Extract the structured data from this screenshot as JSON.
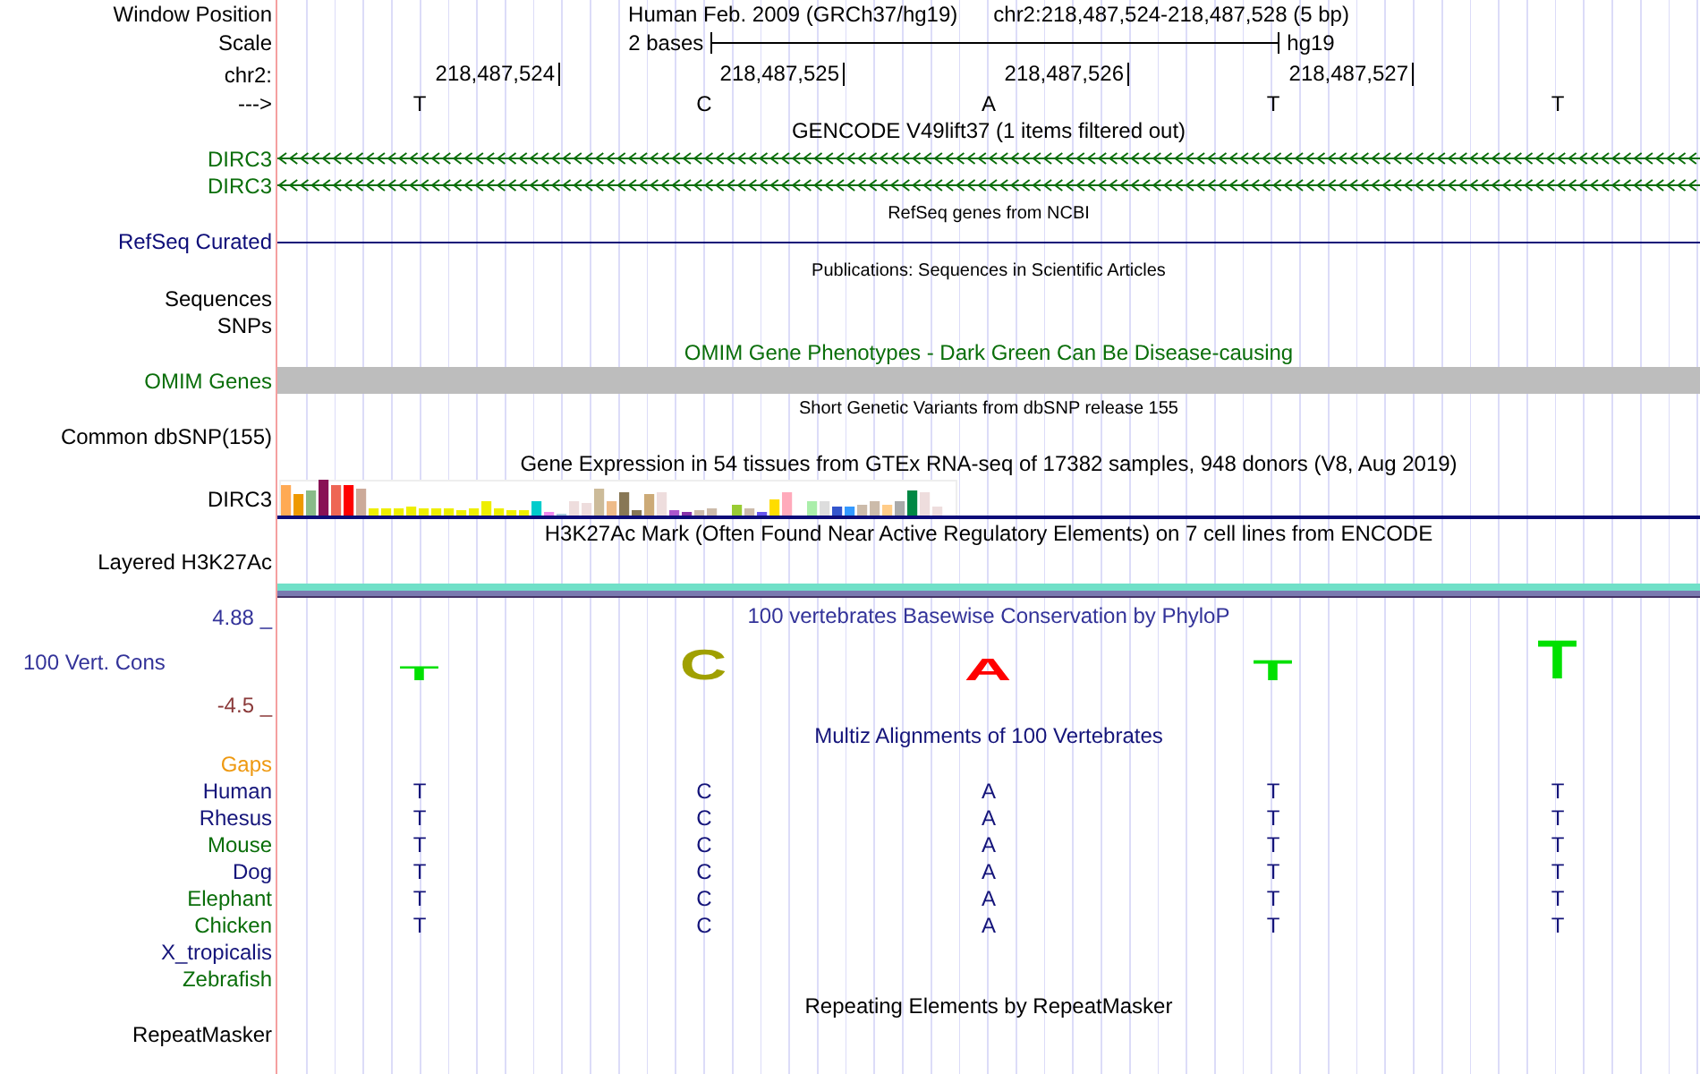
{
  "rows": [
    {
      "kind": "position",
      "label": "Window Position",
      "items": [
        "Human Feb. 2009 (GRCh37/hg19)",
        "chr2:218,487,524-218,487,528 (5 bp)"
      ]
    },
    {
      "kind": "scale",
      "label": "Scale",
      "span": "2 bases",
      "assembly": "hg19"
    },
    {
      "kind": "coords",
      "label": "chr2:",
      "ticks": [
        "218,487,524",
        "218,487,525",
        "218,487,526",
        "218,487,527"
      ]
    },
    {
      "kind": "bases",
      "label": "--->",
      "bases": [
        "T",
        "C",
        "A",
        "T",
        "T"
      ]
    },
    {
      "kind": "title",
      "title": "GENCODE V49lift37 (1 items filtered out)",
      "color": "#000000"
    },
    {
      "kind": "gene",
      "label": "DIRC3",
      "color": "#0a6e0a"
    },
    {
      "kind": "gene",
      "label": "DIRC3",
      "color": "#0a6e0a"
    },
    {
      "kind": "note",
      "title": "RefSeq genes from NCBI"
    },
    {
      "kind": "line",
      "label": "RefSeq Curated",
      "color": "#0c0c78"
    },
    {
      "kind": "note",
      "title": "Publications: Sequences in Scientific Articles"
    },
    {
      "kind": "label",
      "label": "Sequences"
    },
    {
      "kind": "label",
      "label": "SNPs"
    },
    {
      "kind": "title",
      "title": "OMIM Gene Phenotypes - Dark Green Can Be Disease-causing",
      "color": "#0a6e0a"
    },
    {
      "kind": "omim",
      "label": "OMIM Genes",
      "color": "#0a6e0a"
    },
    {
      "kind": "note",
      "title": "Short Genetic Variants from dbSNP release 155"
    },
    {
      "kind": "label",
      "label": "Common dbSNP(155)"
    },
    {
      "kind": "title",
      "title": "Gene Expression in 54 tissues from GTEx RNA-seq of 17382 samples, 948 donors (V8, Aug 2019)",
      "color": "#000000"
    },
    {
      "kind": "expression",
      "label": "DIRC3"
    },
    {
      "kind": "title",
      "title": "H3K27Ac Mark (Often Found Near Active Regulatory Elements) on 7 cell lines from ENCODE",
      "color": "#000000"
    },
    {
      "kind": "layered",
      "label": "Layered H3K27Ac"
    },
    {
      "kind": "conservation",
      "label": "100 Vert. Cons",
      "color": "#333399",
      "max": "4.88 _",
      "min": "-4.5 _",
      "title": "100 vertebrates Basewise Conservation by PhyloP",
      "letters": [
        {
          "letter": "T",
          "color": "#00e000"
        },
        {
          "letter": "C",
          "color": "#a0a000"
        },
        {
          "letter": "A",
          "color": "#ff0000"
        },
        {
          "letter": "T",
          "color": "#00e000"
        },
        {
          "letter": "T",
          "color": "#00e000"
        }
      ]
    },
    {
      "kind": "title",
      "title": "Multiz Alignments of 100 Vertebrates",
      "color": "#14147a"
    },
    {
      "kind": "label",
      "label": "Gaps",
      "color": "#ee9911"
    },
    {
      "kind": "species",
      "label": "Human",
      "color": "#14147a",
      "bases": [
        "T",
        "C",
        "A",
        "T",
        "T"
      ]
    },
    {
      "kind": "species",
      "label": "Rhesus",
      "color": "#14147a",
      "bases": [
        "T",
        "C",
        "A",
        "T",
        "T"
      ]
    },
    {
      "kind": "species",
      "label": "Mouse",
      "color": "#0a6e0a",
      "bases": [
        "T",
        "C",
        "A",
        "T",
        "T"
      ]
    },
    {
      "kind": "species",
      "label": "Dog",
      "color": "#14147a",
      "bases": [
        "T",
        "C",
        "A",
        "T",
        "T"
      ]
    },
    {
      "kind": "species",
      "label": "Elephant",
      "color": "#0a6e0a",
      "bases": [
        "T",
        "C",
        "A",
        "T",
        "T"
      ]
    },
    {
      "kind": "species",
      "label": "Chicken",
      "color": "#0a6e0a",
      "bases": [
        "T",
        "C",
        "A",
        "T",
        "T"
      ]
    },
    {
      "kind": "species",
      "label": "X_tropicalis",
      "color": "#14147a"
    },
    {
      "kind": "species",
      "label": "Zebrafish",
      "color": "#0a6e0a"
    },
    {
      "kind": "title",
      "title": "Repeating Elements by RepeatMasker",
      "color": "#000000"
    },
    {
      "kind": "label",
      "label": "RepeatMasker"
    }
  ]
}
